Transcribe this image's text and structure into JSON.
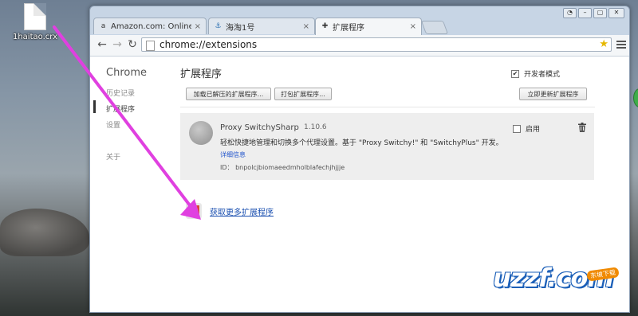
{
  "desktop": {
    "file_label": "1haitao.crx"
  },
  "tabs": [
    {
      "label": "Amazon.com: Online Sh",
      "icon": "amazon-icon"
    },
    {
      "label": "海淘1号",
      "icon": "anchor-icon"
    },
    {
      "label": "扩展程序",
      "icon": "puzzle-icon"
    }
  ],
  "toolbar": {
    "url": "chrome://extensions"
  },
  "sidebar": {
    "title": "Chrome",
    "items": [
      {
        "label": "历史记录"
      },
      {
        "label": "扩展程序"
      },
      {
        "label": "设置"
      },
      {
        "label": "关于"
      }
    ]
  },
  "main": {
    "title": "扩展程序",
    "developer_mode_label": "开发者模式",
    "developer_mode_checked": "✔",
    "buttons": {
      "load_unpacked": "加载已解压的扩展程序...",
      "pack": "打包扩展程序...",
      "update_now": "立即更新扩展程序"
    },
    "extension": {
      "name": "Proxy SwitchySharp",
      "version": "1.10.6",
      "description": "轻松快捷地管理和切换多个代理设置。基于 \"Proxy Switchy!\" 和 \"SwitchyPlus\" 开发。",
      "details": "详细信息",
      "id_label": "ID：",
      "id": "bnpolcjbiomaeedmholblafechjhjjje",
      "enable_label": "启用"
    },
    "more_extensions": "获取更多扩展程序"
  },
  "watermark": {
    "text": "uzzf.com",
    "badge": "东坡下载"
  },
  "colors": {
    "arrow": "#e040e0",
    "link": "#1a4fb0",
    "watermark": "#1b5fb8"
  }
}
